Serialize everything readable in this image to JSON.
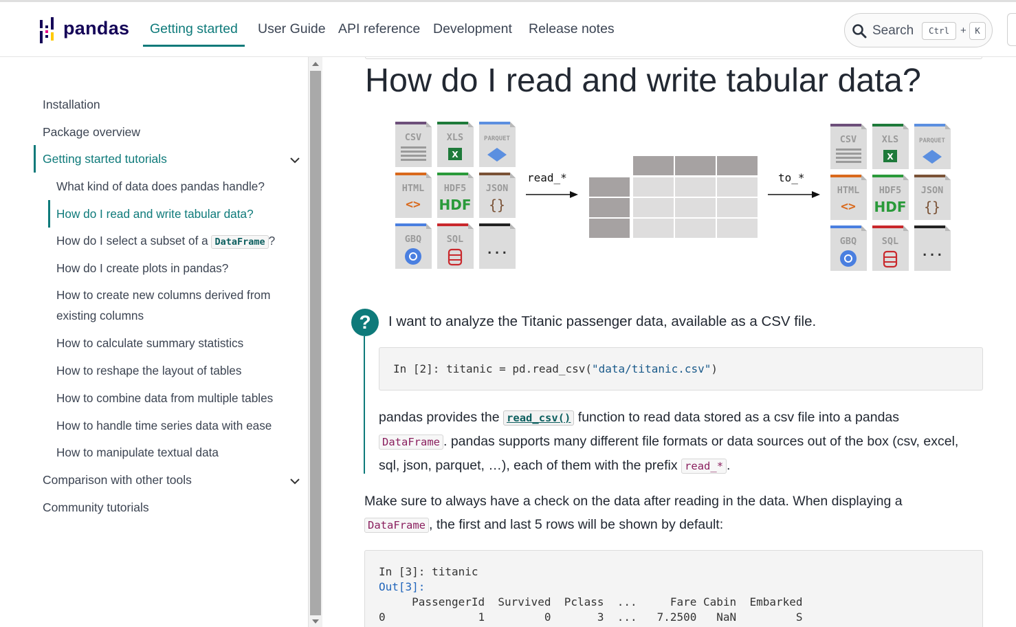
{
  "header": {
    "logo_text": "pandas",
    "nav": [
      {
        "label": "Getting started",
        "active": true
      },
      {
        "label": "User Guide"
      },
      {
        "label": "API reference"
      },
      {
        "label": "Development"
      },
      {
        "label": "Release notes"
      }
    ],
    "search": {
      "label": "Search",
      "shortcut_ctrl": "Ctrl",
      "shortcut_plus": "+",
      "shortcut_key": "K"
    }
  },
  "sidebar": {
    "items": [
      {
        "label": "Installation"
      },
      {
        "label": "Package overview"
      },
      {
        "label": "Getting started tutorials",
        "active": true,
        "expanded": true
      },
      {
        "label": "What kind of data does pandas handle?"
      },
      {
        "label": "How do I read and write tabular data?",
        "active": true
      },
      {
        "label_pre": "How do I select a subset of a",
        "code": "DataFrame",
        "label_post": "?"
      },
      {
        "label": "How do I create plots in pandas?"
      },
      {
        "label_line1": "How to create new columns derived from",
        "label_line2": "existing columns"
      },
      {
        "label": "How to calculate summary statistics"
      },
      {
        "label": "How to reshape the layout of tables"
      },
      {
        "label": "How to combine data from multiple tables"
      },
      {
        "label": "How to handle time series data with ease"
      },
      {
        "label": "How to manipulate textual data"
      },
      {
        "label": "Comparison with other tools",
        "expanded": false
      },
      {
        "label": "Community tutorials"
      }
    ]
  },
  "main": {
    "title": "How do I read and write tabular data?",
    "diagram": {
      "read_label": "read_*",
      "to_label": "to_*",
      "file_types": [
        "CSV",
        "XLS",
        "PARQUET",
        "HTML",
        "HDF5",
        "JSON",
        "GBQ",
        "SQL",
        "..."
      ]
    },
    "question": "I want to analyze the Titanic passenger data, available as a CSV file.",
    "code1": {
      "prompt": "In [2]:",
      "code_pre": " titanic = pd.read_csv(",
      "string": "\"data/titanic.csv\"",
      "code_post": ")"
    },
    "para1": {
      "t1": "pandas provides the ",
      "c1": "read_csv()",
      "t2": " function to read data stored as a csv file into a pandas",
      "c2": "DataFrame",
      "t3": ". pandas supports many different file formats or data sources out of the box (csv, excel,",
      "t4": "sql, json, parquet, …), each of them with the prefix ",
      "c3": "read_*",
      "t5": "."
    },
    "para2": {
      "t1": "Make sure to always have a check on the data after reading in the data. When displaying a",
      "c1": "DataFrame",
      "t2": ", the first and last 5 rows will be shown by default:"
    },
    "code2": {
      "in_line": "In [3]: titanic",
      "out_prompt": "Out[3]:",
      "header_row": "     PassengerId  Survived  Pclass  ...     Fare Cabin  Embarked",
      "row0": "0              1         0       3  ...   7.2500   NaN         S"
    }
  }
}
